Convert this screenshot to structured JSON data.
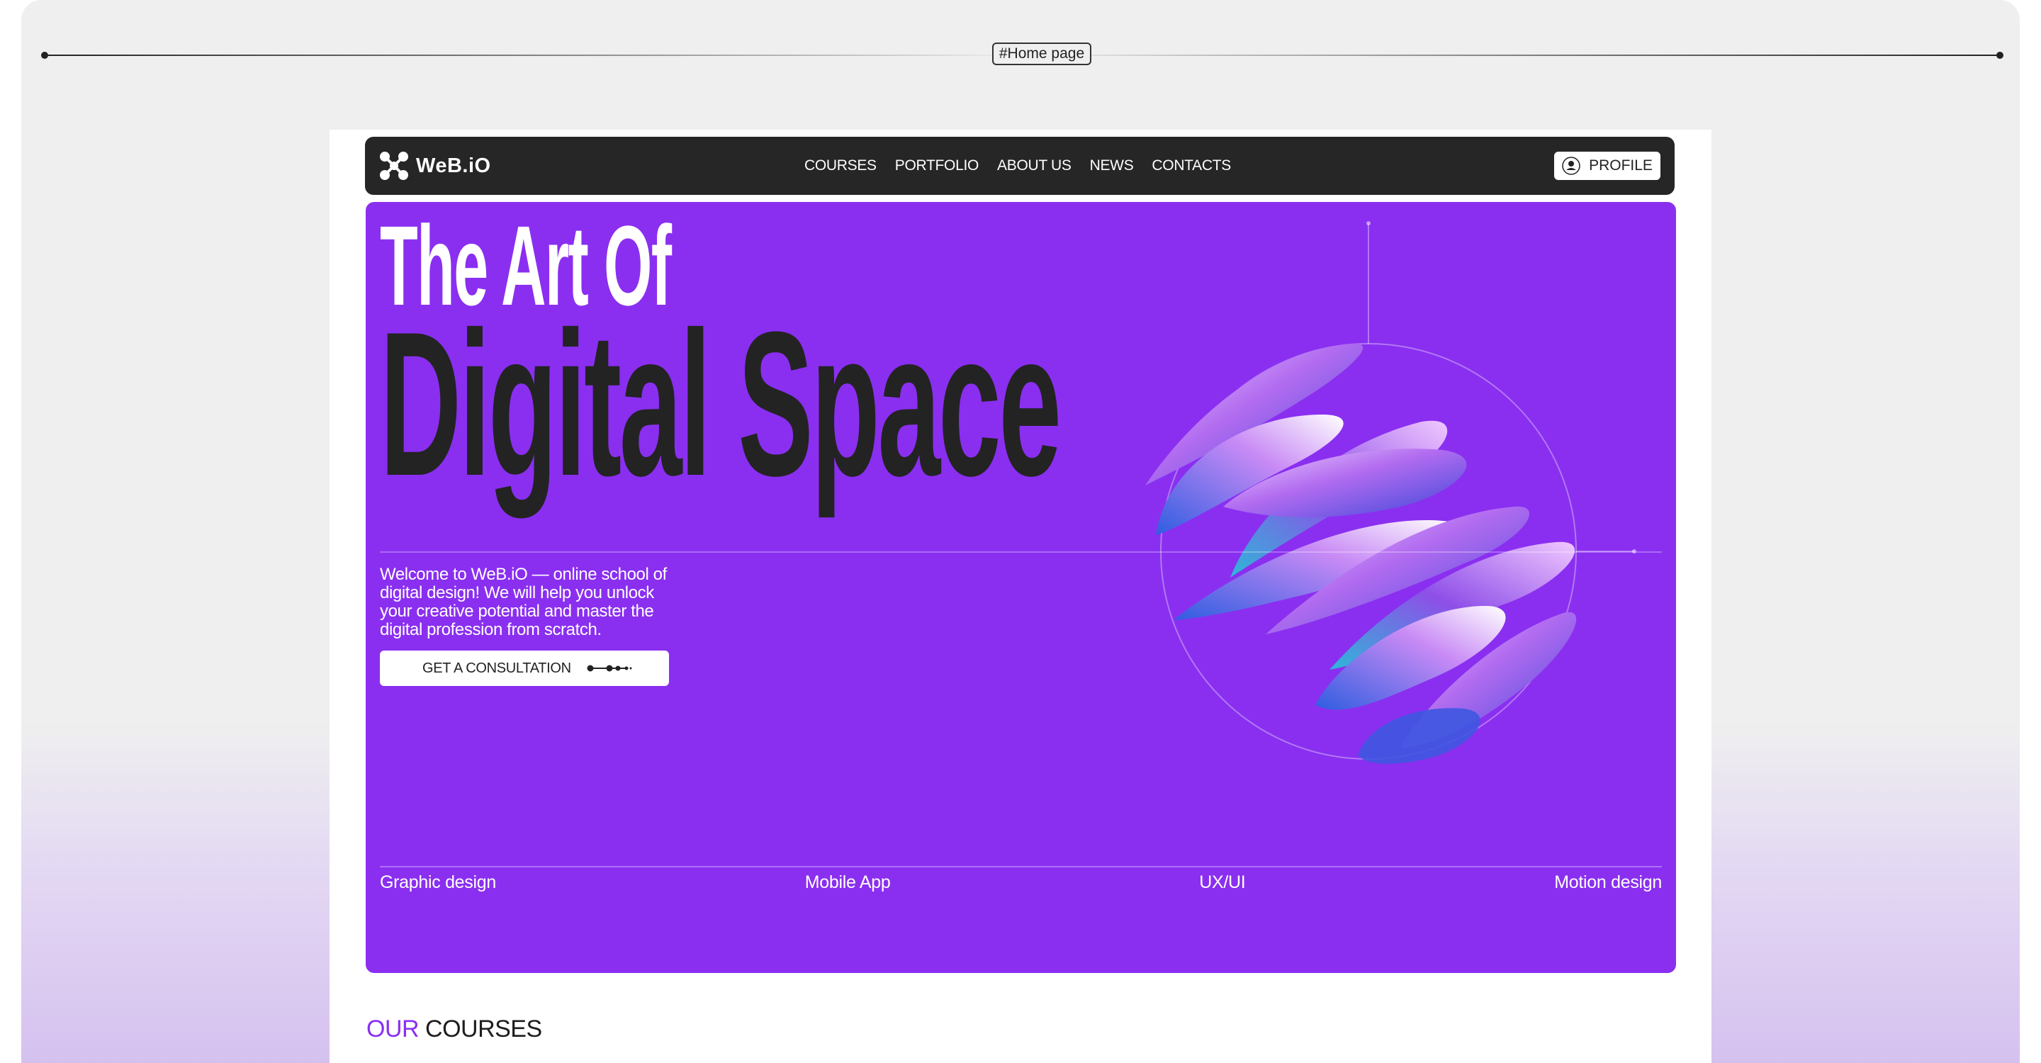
{
  "tag": "#Home page",
  "brand": {
    "name": "WeB.iO"
  },
  "nav": {
    "links": [
      "COURSES",
      "PORTFOLIO",
      "ABOUT US",
      "NEWS",
      "CONTACTS"
    ],
    "profile_label": "PROFILE"
  },
  "hero": {
    "title_line1": "The Art Of",
    "title_line2": "Digital Space",
    "description": "Welcome to WeB.iO — online school of digital design! We will help you unlock your creative potential and master the digital profession from scratch.",
    "cta_label": "GET A CONSULTATION",
    "categories": [
      "Graphic design",
      "Mobile App",
      "UX/UI",
      "Motion design"
    ]
  },
  "courses": {
    "title_accent": "OUR",
    "title_rest": "COURSES"
  },
  "colors": {
    "accent": "#8a2ff0",
    "dark": "#262626",
    "canvas": "#efefef"
  }
}
